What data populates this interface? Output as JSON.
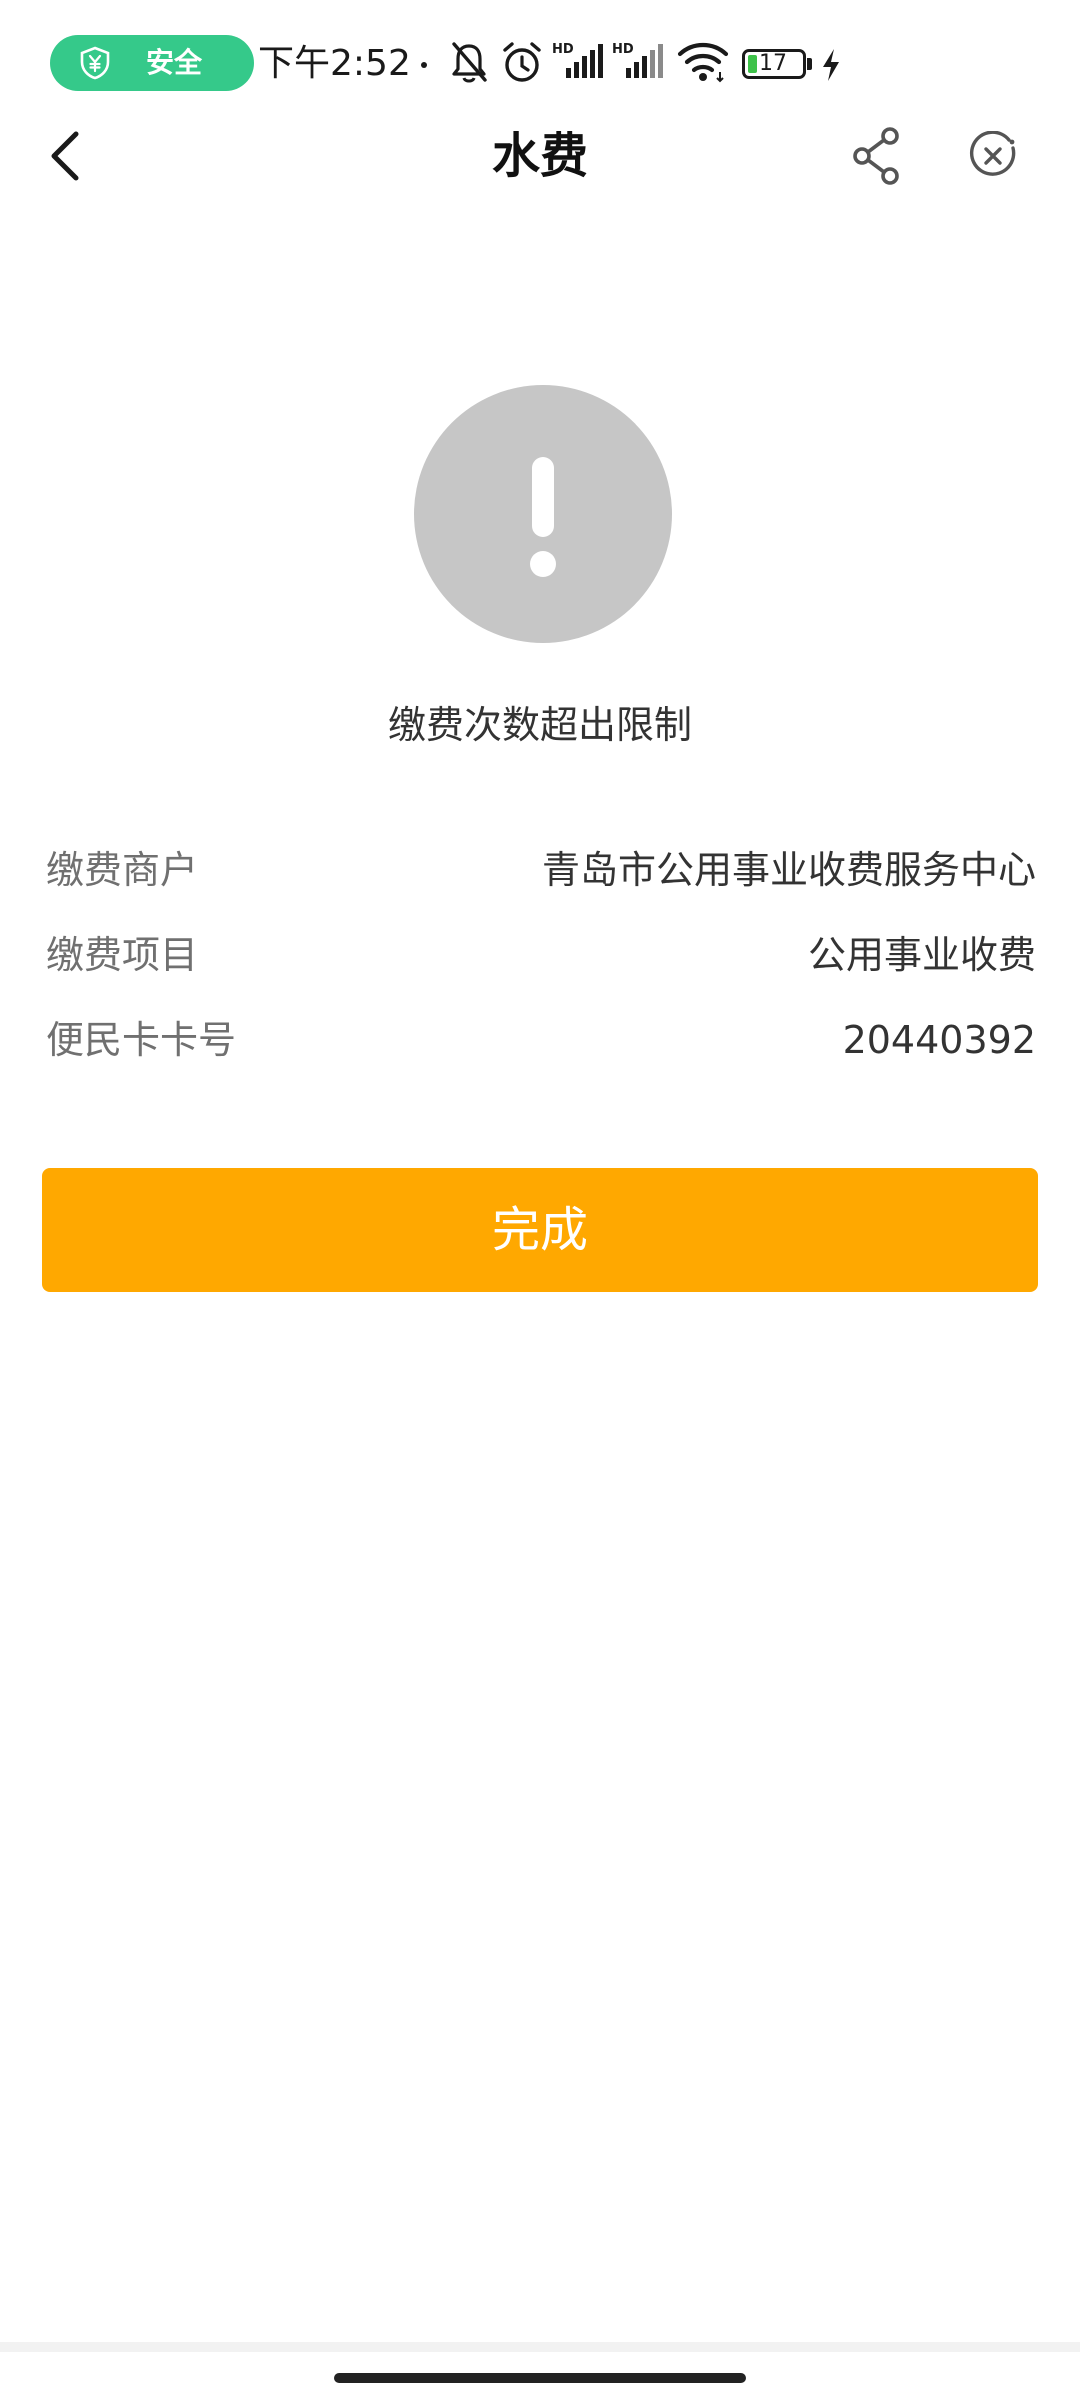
{
  "status_bar": {
    "safe_label": "安全",
    "time": "下午2:52",
    "battery_level": "17",
    "icons": [
      "shield-yen-icon",
      "mute-bell-icon",
      "alarm-icon",
      "hd-signal-icon",
      "hd-signal-icon",
      "wifi-icon",
      "battery-icon",
      "charging-icon"
    ],
    "accent_color": "#35c98a"
  },
  "nav": {
    "title": "水费",
    "icons": [
      "back-arrow-icon",
      "share-icon",
      "close-mini-program-icon"
    ]
  },
  "result": {
    "icon": "exclamation-icon",
    "icon_color": "#c6c6c6",
    "message": "缴费次数超出限制"
  },
  "details": [
    {
      "label": "缴费商户",
      "value": "青岛市公用事业收费服务中心"
    },
    {
      "label": "缴费项目",
      "value": "公用事业收费"
    },
    {
      "label": "便民卡卡号",
      "value": "20440392"
    }
  ],
  "actions": {
    "done_label": "完成",
    "done_color": "#ffa800"
  }
}
